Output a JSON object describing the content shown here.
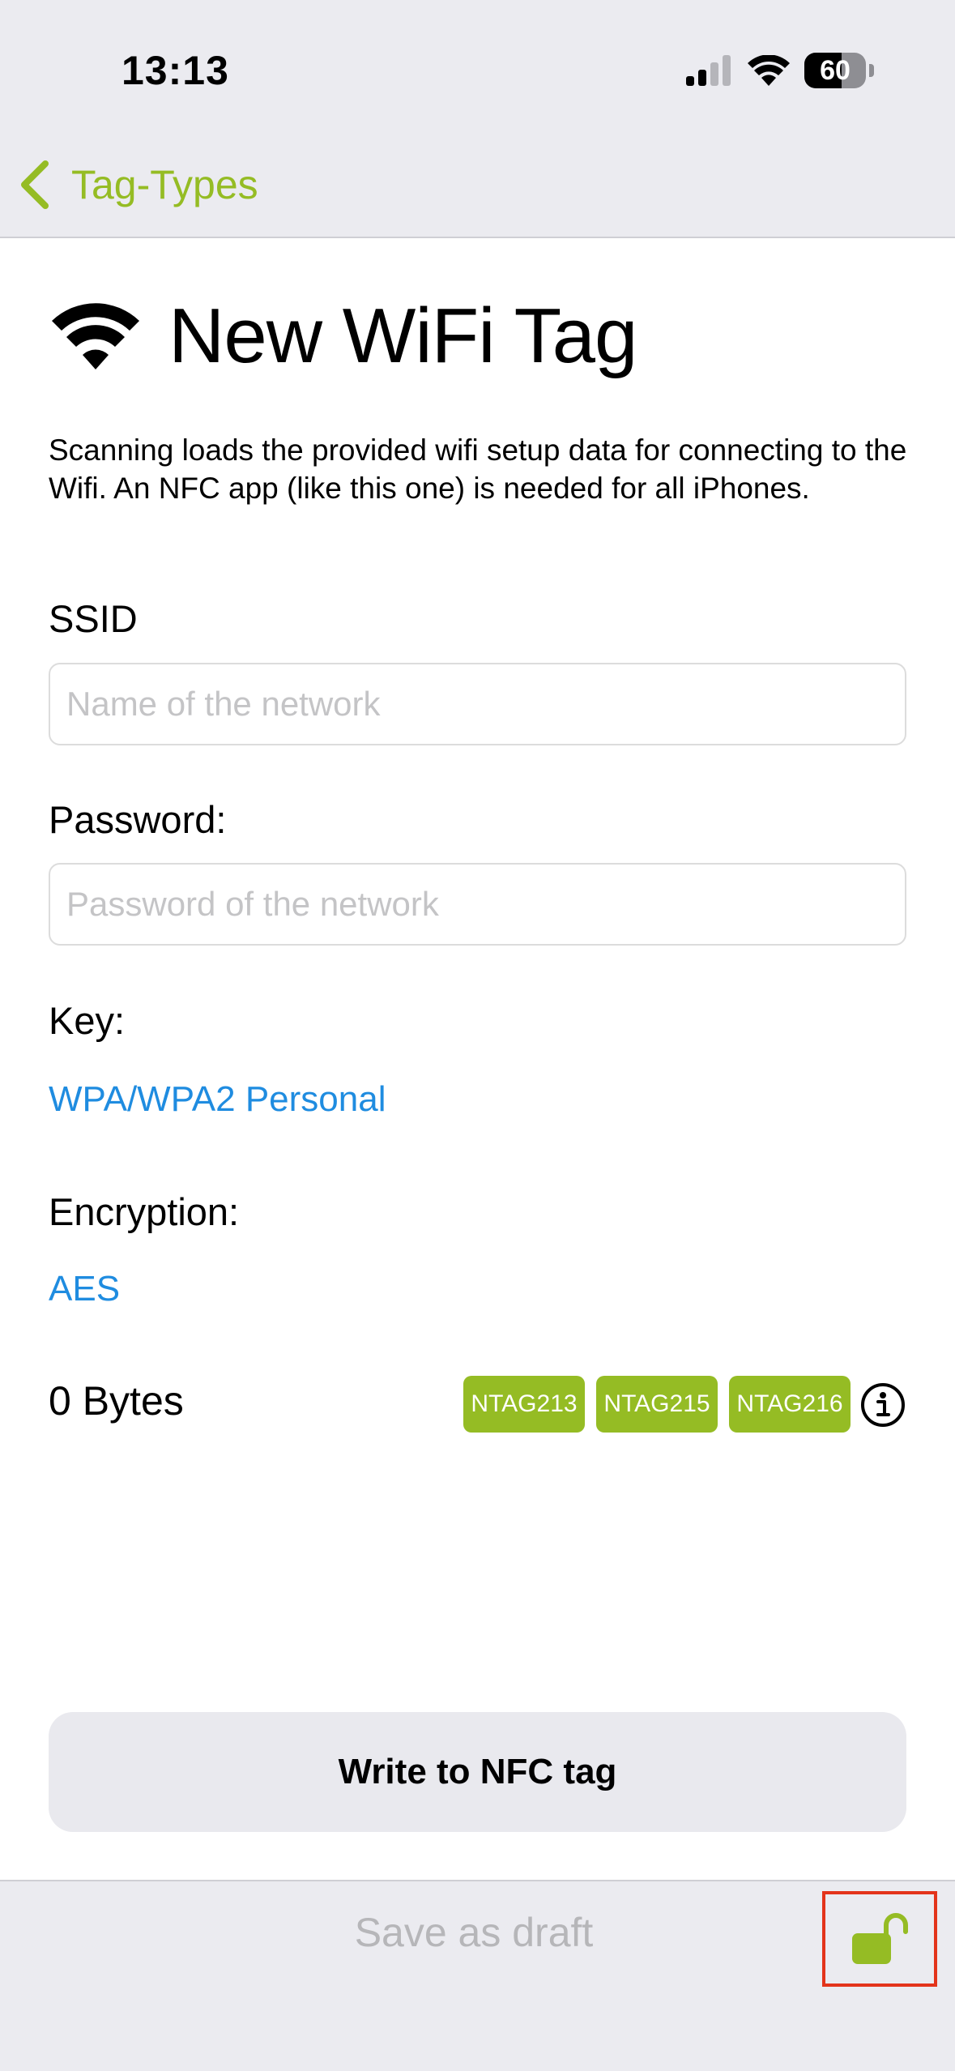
{
  "status_bar": {
    "time": "13:13",
    "battery": "60"
  },
  "nav": {
    "back_label": "Tag-Types"
  },
  "header": {
    "title": "New WiFi Tag"
  },
  "description": "Scanning loads the provided wifi setup data for connecting to the Wifi. An NFC app (like this one) is needed for all iPhones.",
  "form": {
    "ssid_label": "SSID",
    "ssid_value": "",
    "ssid_placeholder": "Name of the network",
    "password_label": "Password:",
    "password_value": "",
    "password_placeholder": "Password of the network",
    "key_label": "Key:",
    "key_value": "WPA/WPA2 Personal",
    "encryption_label": "Encryption:",
    "encryption_value": "AES"
  },
  "size": {
    "bytes": "0 Bytes",
    "tags": [
      "NTAG213",
      "NTAG215",
      "NTAG216"
    ]
  },
  "actions": {
    "write_label": "Write to NFC tag",
    "save_draft_label": "Save as draft"
  },
  "colors": {
    "accent_green": "#95bc24",
    "link_blue": "#1f8ce0",
    "highlight_red": "#e3341b"
  },
  "icons": {
    "back": "chevron-left-icon",
    "title": "wifi-icon",
    "info": "info-circle-icon",
    "lock": "unlocked-padlock-icon"
  }
}
